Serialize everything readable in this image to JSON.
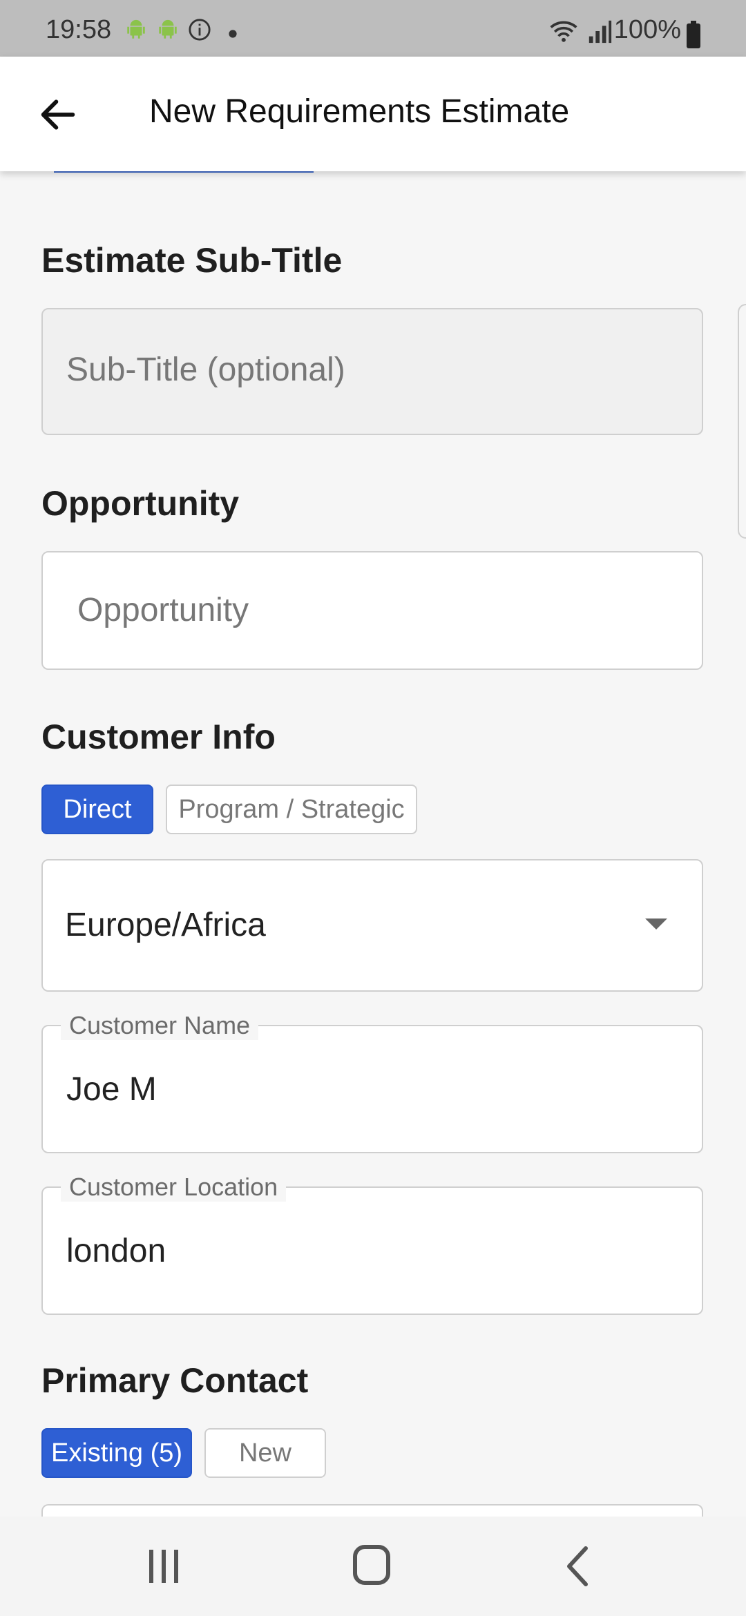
{
  "status_bar": {
    "time": "19:58",
    "battery": "100%",
    "icons": [
      "android-icon",
      "android-icon",
      "info-icon",
      "dot-icon",
      "wifi-icon",
      "signal-icon",
      "battery-icon"
    ]
  },
  "app_bar": {
    "title": "New Requirements Estimate",
    "back_icon": "arrow-left-icon"
  },
  "form": {
    "subtitle_section": {
      "heading": "Estimate Sub-Title",
      "placeholder": "Sub-Title (optional)"
    },
    "opportunity_section": {
      "heading": "Opportunity",
      "placeholder": "Opportunity"
    },
    "customer_info": {
      "heading": "Customer Info",
      "segments": [
        {
          "label": "Direct",
          "active": true
        },
        {
          "label": "Program / Strategic",
          "active": false
        }
      ],
      "region_value": "Europe/Africa",
      "customer_name_label": "Customer Name",
      "customer_name_value": "Joe M",
      "customer_location_label": "Customer Location",
      "customer_location_value": "london"
    },
    "primary_contact": {
      "heading": "Primary Contact",
      "segments": [
        {
          "label": "Existing (5)",
          "active": true
        },
        {
          "label": "New",
          "active": false
        }
      ]
    }
  },
  "nav_bar": {
    "buttons": [
      "recent-apps-icon",
      "home-icon",
      "back-icon"
    ]
  },
  "colors": {
    "accent": "#2e5fd4",
    "status_bar": "#bdbdbd",
    "background": "#f6f6f6"
  }
}
